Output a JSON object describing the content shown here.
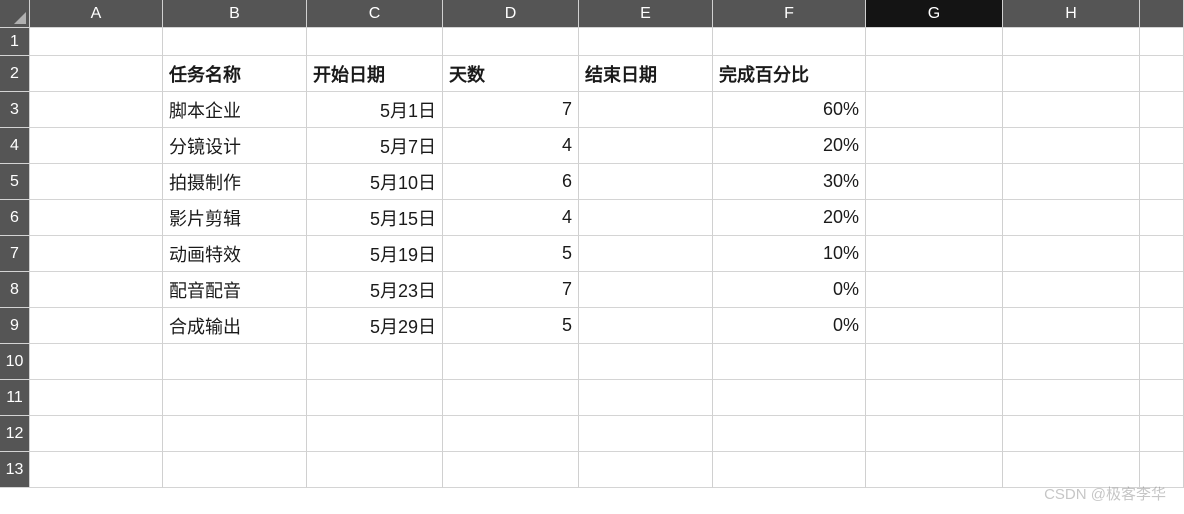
{
  "columns": [
    "",
    "A",
    "B",
    "C",
    "D",
    "E",
    "F",
    "G",
    "H",
    ""
  ],
  "activeColumn": "G",
  "rowCount": 13,
  "headers": {
    "B": "任务名称",
    "C": "开始日期",
    "D": "天数",
    "E": "结束日期",
    "F": "完成百分比"
  },
  "dataRows": [
    {
      "B": "脚本企业",
      "C": "5月1日",
      "D": "7",
      "E": "",
      "F": "60%"
    },
    {
      "B": "分镜设计",
      "C": "5月7日",
      "D": "4",
      "E": "",
      "F": "20%"
    },
    {
      "B": "拍摄制作",
      "C": "5月10日",
      "D": "6",
      "E": "",
      "F": "30%"
    },
    {
      "B": "影片剪辑",
      "C": "5月15日",
      "D": "4",
      "E": "",
      "F": "20%"
    },
    {
      "B": "动画特效",
      "C": "5月19日",
      "D": "5",
      "E": "",
      "F": "10%"
    },
    {
      "B": "配音配音",
      "C": "5月23日",
      "D": "7",
      "E": "",
      "F": "0%"
    },
    {
      "B": "合成输出",
      "C": "5月29日",
      "D": "5",
      "E": "",
      "F": "0%"
    }
  ],
  "watermark": "CSDN @极客李华"
}
